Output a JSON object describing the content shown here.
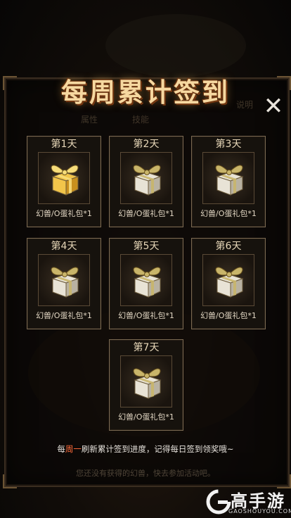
{
  "title": "每周累计签到",
  "background_tabs": [
    "说明",
    "属性",
    "技能"
  ],
  "close_label": "✕",
  "rewards": [
    {
      "day": "第1天",
      "item": "幻兽/O蛋礼包*1",
      "state": "claimed-gold"
    },
    {
      "day": "第2天",
      "item": "幻兽/O蛋礼包*1",
      "state": "locked"
    },
    {
      "day": "第3天",
      "item": "幻兽/O蛋礼包*1",
      "state": "locked"
    },
    {
      "day": "第4天",
      "item": "幻兽/O蛋礼包*1",
      "state": "locked"
    },
    {
      "day": "第5天",
      "item": "幻兽/O蛋礼包*1",
      "state": "locked"
    },
    {
      "day": "第6天",
      "item": "幻兽/O蛋礼包*1",
      "state": "locked"
    },
    {
      "day": "第7天",
      "item": "幻兽/O蛋礼包*1",
      "state": "locked"
    }
  ],
  "notice": {
    "prefix": "每",
    "highlight": "周一",
    "suffix": "刷新累计签到进度，记得每日签到领奖哦~"
  },
  "background_hint": "您还没有获得的幻兽，快去参加活动吧。",
  "watermark": {
    "brand": "高手游",
    "url": "GAOSHOUYOU.COM"
  },
  "colors": {
    "gold": "#f2c54a",
    "silver": "#e8e3d6",
    "highlight": "#ff6a3a"
  }
}
